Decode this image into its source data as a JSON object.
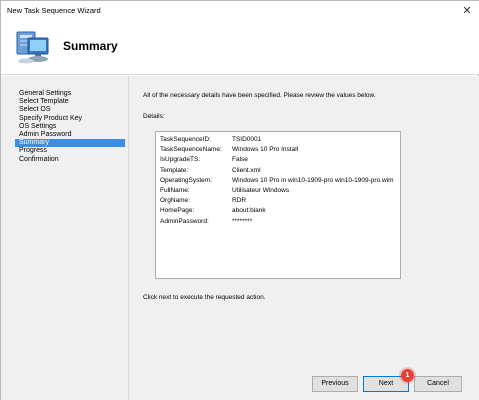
{
  "window": {
    "title": "New Task Sequence Wizard",
    "close_glyph": "✕"
  },
  "header": {
    "icon": "computer-icon",
    "page_title": "Summary"
  },
  "sidebar": {
    "items": [
      {
        "label": "General Settings",
        "active": false
      },
      {
        "label": "Select Template",
        "active": false
      },
      {
        "label": "Select OS",
        "active": false
      },
      {
        "label": "Specify Product Key",
        "active": false
      },
      {
        "label": "OS Settings",
        "active": false
      },
      {
        "label": "Admin Password",
        "active": false
      },
      {
        "label": "Summary",
        "active": true
      },
      {
        "label": "Progress",
        "active": false
      },
      {
        "label": "Confirmation",
        "active": false
      }
    ],
    "active_color": "#3a8ee6"
  },
  "main": {
    "intro": "All of the necessary details have been specified.  Please review the values below.",
    "details_label": "Details:",
    "details": [
      {
        "key": "TaskSequenceID:",
        "value": "TSID0001"
      },
      {
        "key": "TaskSequenceName:",
        "value": "Windows 10 Pro Install"
      },
      {
        "key": "IsUpgradeTS:",
        "value": "False"
      },
      {
        "key": "Template:",
        "value": "Client.xml"
      },
      {
        "key": "OperatingSystem:",
        "value": "Windows 10 Pro in win10-1909-pro win10-1909-pro.wim"
      },
      {
        "key": "FullName:",
        "value": "Utilisateur Windows"
      },
      {
        "key": "OrgName:",
        "value": "RDR"
      },
      {
        "key": "HomePage:",
        "value": "about:blank"
      },
      {
        "key": "AdminPassword:",
        "value": "********"
      }
    ],
    "footer_text": "Click next to execute the requested action."
  },
  "buttons": {
    "previous": "Previous",
    "next": "Next",
    "cancel": "Cancel"
  },
  "annotation": {
    "badge": "1",
    "color": "#e34234"
  }
}
